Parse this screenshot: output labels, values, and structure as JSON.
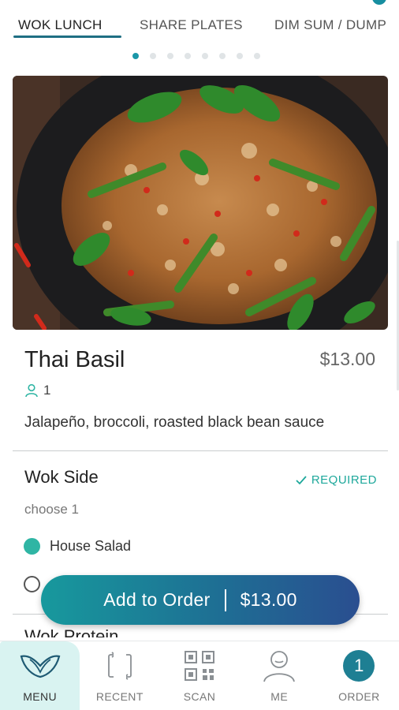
{
  "tabs": [
    {
      "label": "WOK LUNCH",
      "active": true
    },
    {
      "label": "SHARE PLATES",
      "active": false
    },
    {
      "label": "DIM SUM / DUMP",
      "active": false
    }
  ],
  "pager": {
    "total": 8,
    "active_index": 0
  },
  "item": {
    "name": "Thai Basil",
    "price": "$13.00",
    "serves": "1",
    "description": "Jalapeño, broccoli, roasted black bean sauce",
    "hero_icon": "wok-food-photo"
  },
  "wok_side": {
    "title": "Wok Side",
    "required_label": "REQUIRED",
    "choose": "choose 1",
    "options": [
      {
        "label": "House Salad",
        "selected": true
      },
      {
        "label": "",
        "selected": false
      }
    ]
  },
  "next_section": {
    "title": "Wok Protein"
  },
  "add_button": {
    "label": "Add to Order",
    "price": "$13.00"
  },
  "nav": {
    "menu": "MENU",
    "recent": "RECENT",
    "scan": "SCAN",
    "me": "ME",
    "order": "ORDER",
    "order_count": "1"
  },
  "colors": {
    "accent": "#1a97a8",
    "required": "#1ea89b",
    "radio_selected": "#2fb5a4",
    "nav_active_bg": "#d9f3f1",
    "badge": "#1e7f93"
  }
}
